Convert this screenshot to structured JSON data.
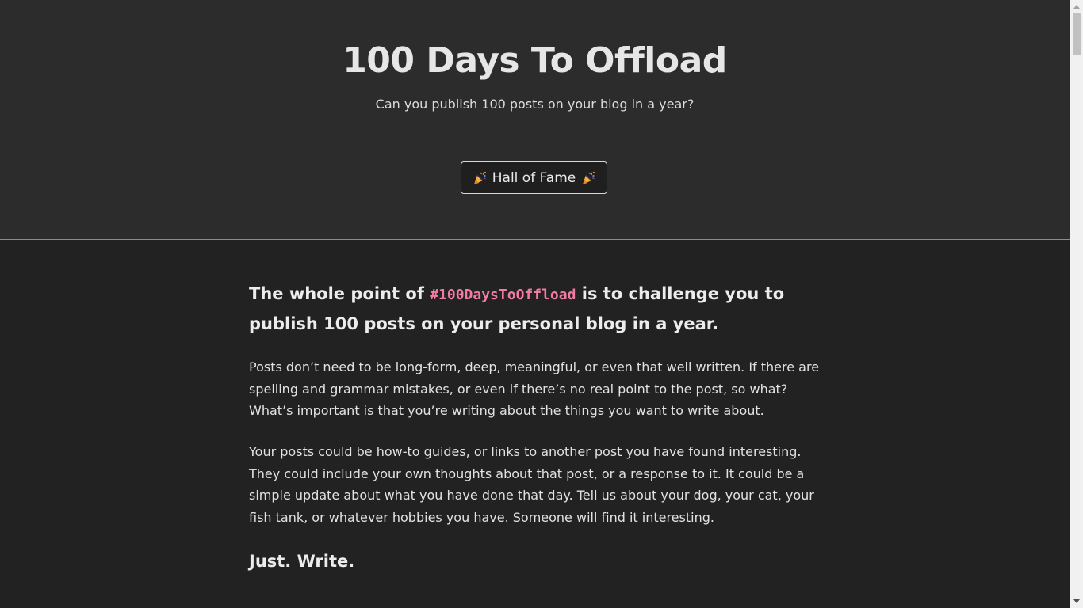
{
  "hero": {
    "title": "100 Days To Offload",
    "subtitle": "Can you publish 100 posts on your blog in a year?",
    "fame_button_label": "Hall of Fame"
  },
  "main": {
    "lead_prefix": "The whole point of ",
    "lead_hashtag": "#100DaysToOffload",
    "lead_suffix": " is to challenge you to publish 100 posts on your personal blog in a year.",
    "paragraphs": [
      "Posts don’t need to be long-form, deep, meaningful, or even that well written. If there are spelling and grammar mistakes, or even if there’s no real point to the post, so what? What’s important is that you’re writing about the things you want to write about.",
      "Your posts could be how-to guides, or links to another post you have found interesting. They could include your own thoughts about that post, or a response to it. It could be a simple update about what you have done that day. Tell us about your dog, your cat, your fish tank, or whatever hobbies you have. Someone will find it interesting."
    ],
    "closing": "Just. Write."
  },
  "icons": {
    "party": "party-popper-icon",
    "scroll_up": "scroll-up-arrow-icon",
    "scroll_down": "scroll-down-arrow-icon"
  },
  "colors": {
    "hero_bg": "#2c2c2d",
    "page_bg": "#222223",
    "hashtag": "#f27aa4",
    "divider": "#8d8b98"
  }
}
